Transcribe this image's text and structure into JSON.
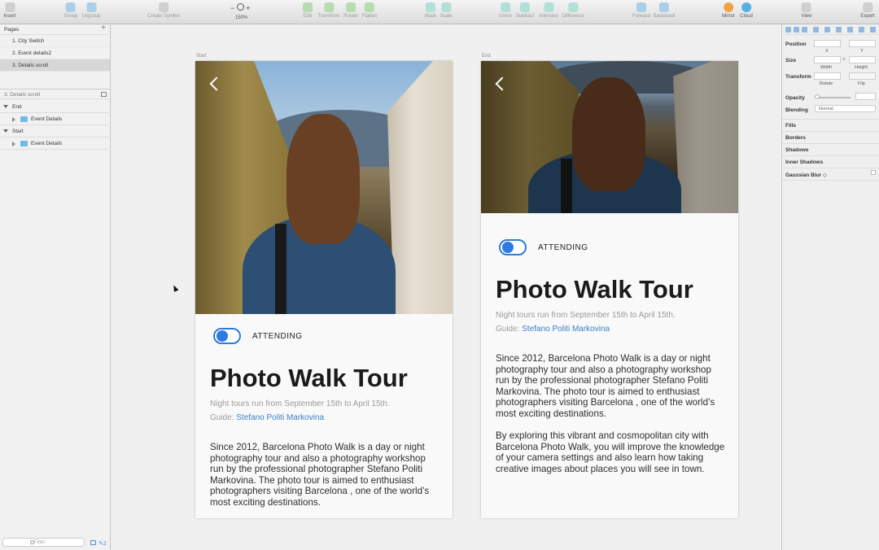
{
  "toolbar": {
    "insert": "Insert",
    "group": "Group",
    "ungroup": "Ungroup",
    "create_symbol": "Create Symbol",
    "zoom_minus": "−",
    "zoom_plus": "+",
    "zoom_level": "150%",
    "edit": "Edit",
    "transform": "Transform",
    "rotate": "Rotate",
    "flatten": "Flatten",
    "mask": "Mask",
    "scale": "Scale",
    "union": "Union",
    "subtract": "Subtract",
    "intersect": "Intersect",
    "difference": "Difference",
    "forward": "Forward",
    "backward": "Backward",
    "mirror": "Mirror",
    "cloud": "Cloud",
    "view": "View",
    "export": "Export"
  },
  "pages": {
    "header": "Pages",
    "items": [
      {
        "label": "1. City Switch"
      },
      {
        "label": "2. Event details2"
      },
      {
        "label": "3. Details scroll"
      }
    ]
  },
  "layers": {
    "header": "3. Details scroll",
    "groups": [
      {
        "label": "End",
        "child": "Event Details"
      },
      {
        "label": "Start",
        "child": "Event Details"
      }
    ],
    "filter_placeholder": "Filter",
    "count": "2"
  },
  "artboards": [
    {
      "label": "Start",
      "attending": "ATTENDING",
      "title": "Photo Walk Tour",
      "subtitle": "Night tours run from September 15th to April 15th.",
      "guide_prefix": "Guide:",
      "guide_name": "Stefano Politi Markovina",
      "paragraphs": [
        "Since 2012, Barcelona Photo Walk is a day or night photography tour and also a photography workshop run by the professional photographer Stefano Politi Markovina. The photo tour is aimed to enthusiast photographers visiting Barcelona , one of the world’s most exciting destinations."
      ]
    },
    {
      "label": "End",
      "attending": "ATTENDING",
      "title": "Photo Walk Tour",
      "subtitle": "Night tours run from September 15th to April 15th.",
      "guide_prefix": "Guide:",
      "guide_name": "Stefano Politi Markovina",
      "paragraphs": [
        "Since 2012, Barcelona Photo Walk is a day or night photography tour and also a photography workshop run by the professional photographer Stefano Politi Markovina. The photo tour is aimed to enthusiast photographers visiting Barcelona , one of the world’s most exciting destinations.",
        "By exploring this vibrant and cosmopolitan city with Barcelona Photo Walk, you will improve the knowledge of your camera settings and also learn how taking creative images about places you will see in town."
      ]
    }
  ],
  "inspector": {
    "position": "Position",
    "x": "X",
    "y": "Y",
    "size": "Size",
    "width": "Width",
    "height": "Height",
    "transform": "Transform",
    "rotate": "Rotate",
    "flip": "Flip",
    "opacity": "Opacity",
    "blending": "Blending",
    "blending_value": "Normal",
    "fills": "Fills",
    "borders": "Borders",
    "shadows": "Shadows",
    "inner_shadows": "Inner Shadows",
    "gaussian_blur": "Gaussian Blur"
  },
  "colors": {
    "accent": "#2d7be0",
    "link": "#3a7fc8"
  }
}
